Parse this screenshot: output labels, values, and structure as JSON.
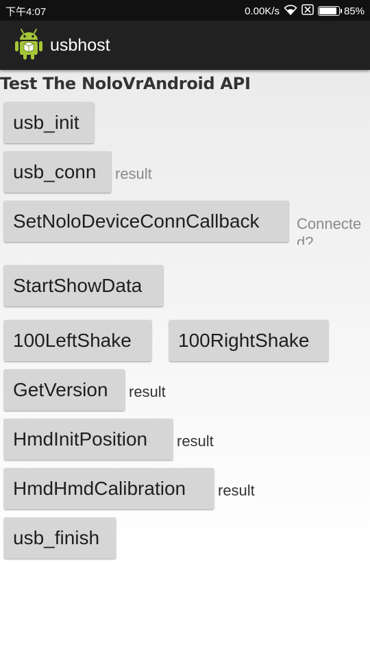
{
  "status_bar": {
    "time": "下午4:07",
    "network_speed": "0.00K/s",
    "battery_percent": "85%",
    "battery_level": 0.85,
    "icons": [
      "wifi-icon",
      "sim-icon",
      "battery-icon"
    ]
  },
  "app_bar": {
    "title": "usbhost",
    "icon": "android-icon"
  },
  "main": {
    "heading": "Test The NoloVrAndroid API",
    "buttons": {
      "usb_init": "usb_init",
      "usb_conn": "usb_conn",
      "set_callback": "SetNoloDeviceConnCallback",
      "start_show_data": "StartShowData",
      "left_shake": "100LeftShake",
      "right_shake": "100RightShake",
      "get_version": "GetVersion",
      "hmd_init_position": "HmdInitPosition",
      "hmd_calibration": "HmdHmdCalibration",
      "usb_finish": "usb_finish"
    },
    "results": {
      "usb_conn_result": "result",
      "connected_status": "Connected?",
      "get_version_result": "result",
      "hmd_init_position_result": "result",
      "hmd_calibration_result": "result"
    }
  },
  "colors": {
    "status_bar_bg": "#111111",
    "app_bar_bg": "#212121",
    "button_bg": "#d6d6d6",
    "android_green": "#a4c639"
  }
}
